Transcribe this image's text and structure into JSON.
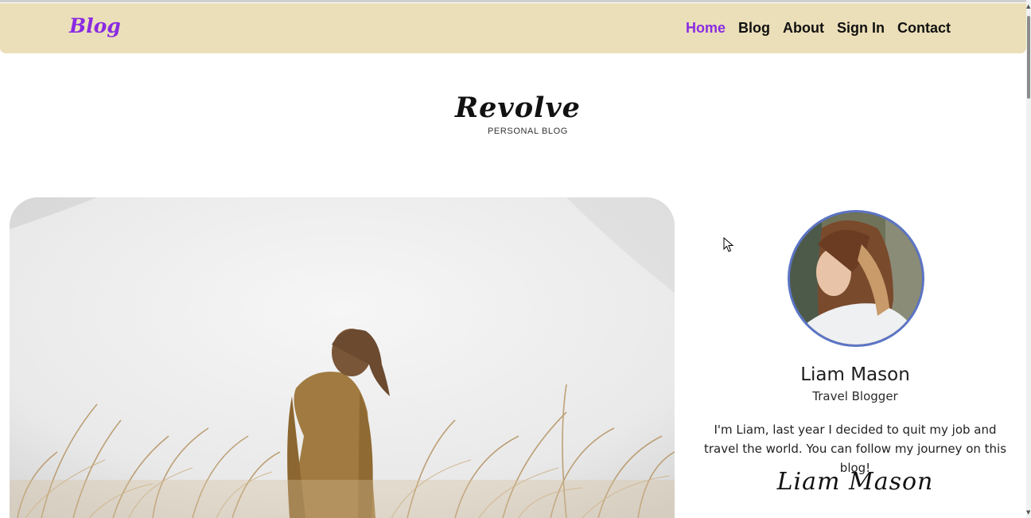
{
  "navbar": {
    "brand": "Blog",
    "links": [
      {
        "label": "Home",
        "active": true
      },
      {
        "label": "Blog",
        "active": false
      },
      {
        "label": "About",
        "active": false
      },
      {
        "label": "Sign In",
        "active": false
      },
      {
        "label": "Contact",
        "active": false
      }
    ],
    "accent_color": "#8a2be2",
    "background_color": "#ebdfb9"
  },
  "logo": {
    "word": "Revolve",
    "tagline": "PERSONAL BLOG"
  },
  "sidebar": {
    "name": "Liam Mason",
    "role": "Travel Blogger",
    "bio": "I'm Liam, last year I decided to quit my job and travel the world. You can follow my journey on this blog!",
    "signature": "Liam Mason"
  },
  "icons": {
    "cursor": "cursor-arrow-icon",
    "scroll_up": "scroll-up-arrow-icon",
    "scroll_down": "scroll-down-arrow-icon"
  }
}
